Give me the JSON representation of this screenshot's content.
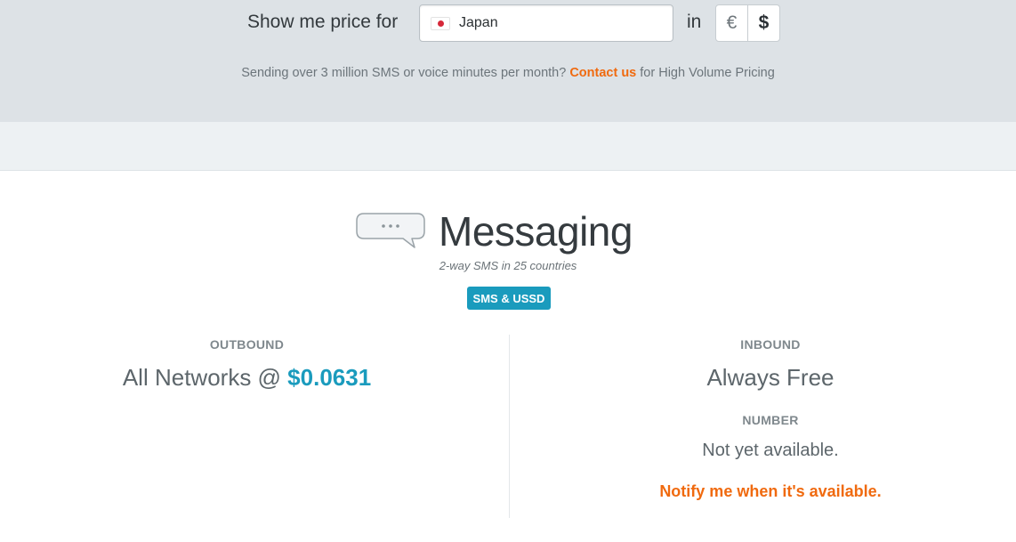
{
  "price_selector": {
    "label": "Show me price for",
    "country": "Japan",
    "flag_icon": "japan-flag-icon",
    "in_label": "in",
    "currencies": [
      "€",
      "$"
    ],
    "selected_currency": "$"
  },
  "volume_note": {
    "prefix": "Sending over 3 million SMS or voice minutes per month?",
    "link": "Contact us",
    "suffix": "for High Volume Pricing"
  },
  "messaging": {
    "icon": "speech-bubble-icon",
    "title": "Messaging",
    "subtitle": "2-way SMS in 25 countries",
    "badge": "SMS & USSD"
  },
  "outbound": {
    "heading": "OUTBOUND",
    "networks_label": "All Networks @",
    "price": "$0.0631"
  },
  "inbound": {
    "heading": "INBOUND",
    "value": "Always Free",
    "number_heading": "NUMBER",
    "number_status": "Not yet available.",
    "notify_link": "Notify me when it's available."
  },
  "colors": {
    "accent_blue": "#1a9bbd",
    "accent_orange": "#f06a0f",
    "header_bg": "#dde2e6"
  }
}
